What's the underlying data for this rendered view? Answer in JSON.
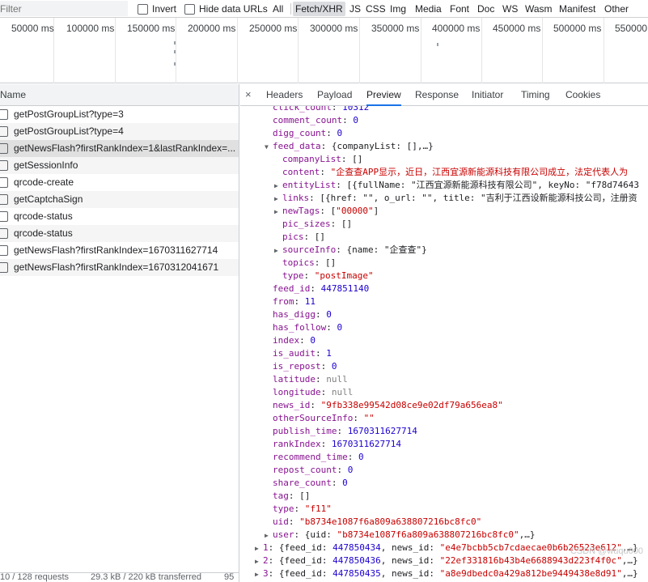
{
  "filter": {
    "placeholder": "Filter",
    "invert_label": "Invert",
    "hide_data_urls_label": "Hide data URLs",
    "types": [
      "All",
      "Fetch/XHR",
      "JS",
      "CSS",
      "Img",
      "Media",
      "Font",
      "Doc",
      "WS",
      "Wasm",
      "Manifest",
      "Other"
    ],
    "active_type": "Fetch/XHR"
  },
  "timeline": {
    "ticks": [
      "50000 ms",
      "100000 ms",
      "150000 ms",
      "200000 ms",
      "250000 ms",
      "300000 ms",
      "350000 ms",
      "400000 ms",
      "450000 ms",
      "500000 ms",
      "550000"
    ]
  },
  "requests": {
    "column_name": "Name",
    "items": [
      "getPostGroupList?type=3",
      "getPostGroupList?type=4",
      "getNewsFlash?firstRankIndex=1&lastRankIndex=...",
      "getSessionInfo",
      "qrcode-create",
      "getCaptchaSign",
      "qrcode-status",
      "qrcode-status",
      "getNewsFlash?firstRankIndex=1670311627714",
      "getNewsFlash?firstRankIndex=1670312041671"
    ],
    "selected_index": 2
  },
  "status": {
    "requests": "10 / 128 requests",
    "transferred": "29.3 kB / 220 kB transferred",
    "resources": "95"
  },
  "detail": {
    "close_glyph": "×",
    "tabs": [
      "Headers",
      "Payload",
      "Preview",
      "Response",
      "Initiator",
      "Timing",
      "Cookies"
    ],
    "active_tab": "Preview"
  },
  "preview": {
    "click_count_key": "click_count",
    "click_count": "10312",
    "comment_count_key": "comment_count",
    "comment_count": "0",
    "digg_count_key": "digg_count",
    "digg_count": "0",
    "feed_data_key": "feed_data",
    "feed_data_summary": "{companyList: [],…}",
    "companyList_key": "companyList",
    "companyList": "[]",
    "content_key": "content",
    "content": "\"企查查APP显示，近日，江西宜源新能源科技有限公司成立，法定代表人为",
    "entityList_key": "entityList",
    "entityList": "[{fullName: \"江西宜源新能源科技有限公司\", keyNo: \"f78d74643",
    "links_key": "links",
    "links": "[{href: \"\", o_url: \"\", title: \"吉利于江西设新能源科技公司，注册资",
    "newTags_key": "newTags",
    "newTags_value": "\"00000\"",
    "pic_sizes_key": "pic_sizes",
    "pic_sizes": "[]",
    "pics_key": "pics",
    "pics": "[]",
    "sourceInfo_key": "sourceInfo",
    "sourceInfo_name": "\"企查查\"",
    "topics_key": "topics",
    "topics": "[]",
    "type_key": "type",
    "type_inner": "\"postImage\"",
    "feed_id_key": "feed_id",
    "feed_id": "447851140",
    "from_key": "from",
    "from": "11",
    "has_digg_key": "has_digg",
    "has_digg": "0",
    "has_follow_key": "has_follow",
    "has_follow": "0",
    "index_key": "index",
    "index": "0",
    "is_audit_key": "is_audit",
    "is_audit": "1",
    "is_repost_key": "is_repost",
    "is_repost": "0",
    "latitude_key": "latitude",
    "latitude": "null",
    "longitude_key": "longitude",
    "longitude": "null",
    "news_id_key": "news_id",
    "news_id": "\"9fb338e99542d08ce9e02df79a656ea8\"",
    "otherSourceInfo_key": "otherSourceInfo",
    "otherSourceInfo": "\"\"",
    "publish_time_key": "publish_time",
    "publish_time": "1670311627714",
    "rankIndex_key": "rankIndex",
    "rankIndex": "1670311627714",
    "recommend_time_key": "recommend_time",
    "recommend_time": "0",
    "repost_count_key": "repost_count",
    "repost_count": "0",
    "share_count_key": "share_count",
    "share_count": "0",
    "tag_key": "tag",
    "tag": "[]",
    "type_outer_key": "type",
    "type_outer": "\"f11\"",
    "uid_key": "uid",
    "uid": "\"b8734e1087f6a809a638807216bc8fc0\"",
    "user_key": "user",
    "user_uid": "\"b8734e1087f6a809a638807216bc8fc0\"",
    "item1_key": "1",
    "item1_feed_id": "447850434",
    "item1_news_id": "\"e4e7bcbb5cb7cdaecae0b6b26523e612\"",
    "item2_key": "2",
    "item2_feed_id": "447850436",
    "item2_news_id": "\"22ef331816b43b4e6688943d223f4f0c\"",
    "item3_key": "3",
    "item3_feed_id": "447850435",
    "item3_news_id": "\"a8e9dbedc0a429a812be9449438e8d91\""
  },
  "watermark": "CSDN @wuqu000"
}
